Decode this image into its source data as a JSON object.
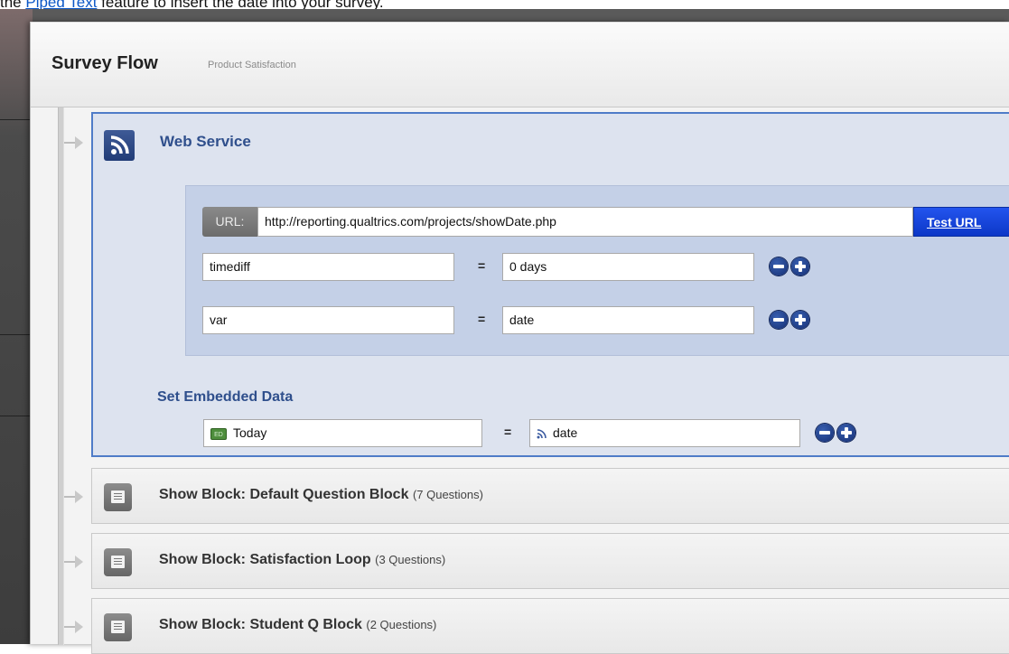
{
  "intro": {
    "prefix": "the ",
    "link": "Piped Text",
    "suffix": " feature to insert the date into your survey."
  },
  "dialog": {
    "title": "Survey Flow",
    "subtitle": "Product Satisfaction"
  },
  "web_service": {
    "title": "Web Service",
    "icon": "rss-icon",
    "url_label": "URL:",
    "url_value": "http://reporting.qualtrics.com/projects/showDate.php",
    "test_url_label": "Test URL",
    "params": [
      {
        "key": "timediff",
        "value": "0 days"
      },
      {
        "key": "var",
        "value": "date"
      }
    ],
    "equals": "="
  },
  "embedded_data": {
    "title": "Set Embedded Data",
    "field_tag": "ED",
    "field": "Today",
    "value": "date"
  },
  "blocks": [
    {
      "label": "Show Block: Default Question Block",
      "count": "(7 Questions)"
    },
    {
      "label": "Show Block: Satisfaction Loop",
      "count": "(3 Questions)"
    },
    {
      "label": "Show Block: Student Q Block",
      "count": "(2 Questions)"
    }
  ],
  "colors": {
    "accent": "#2f4f8c",
    "test_url_button": "#1645e0",
    "selected_border": "#4f7cc8"
  }
}
